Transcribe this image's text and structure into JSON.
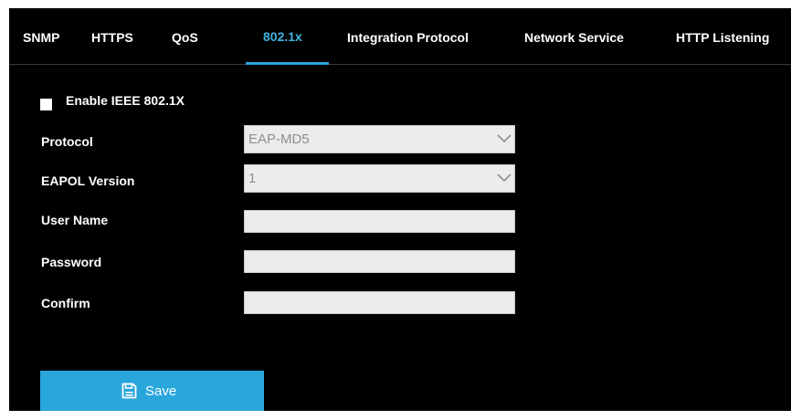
{
  "tabs": [
    {
      "label": "SNMP"
    },
    {
      "label": "HTTPS"
    },
    {
      "label": "QoS"
    },
    {
      "label": "802.1x"
    },
    {
      "label": "Integration Protocol"
    },
    {
      "label": "Network Service"
    },
    {
      "label": "HTTP Listening"
    }
  ],
  "active_tab": "802.1x",
  "enable": {
    "label": "Enable IEEE 802.1X",
    "checked": false
  },
  "protocol": {
    "label": "Protocol",
    "value": "EAP-MD5"
  },
  "eapol": {
    "label": "EAPOL Version",
    "value": "1"
  },
  "username": {
    "label": "User Name",
    "value": ""
  },
  "password": {
    "label": "Password",
    "value": ""
  },
  "confirm": {
    "label": "Confirm",
    "value": ""
  },
  "save": {
    "label": "Save"
  },
  "icons": {
    "dropdown": "chevron-down-icon",
    "save": "floppy-disk-icon"
  },
  "colors": {
    "background": "#000000",
    "accent": "#29a6dc",
    "active_tab_text": "#40b3e0",
    "field": "#ececec"
  }
}
